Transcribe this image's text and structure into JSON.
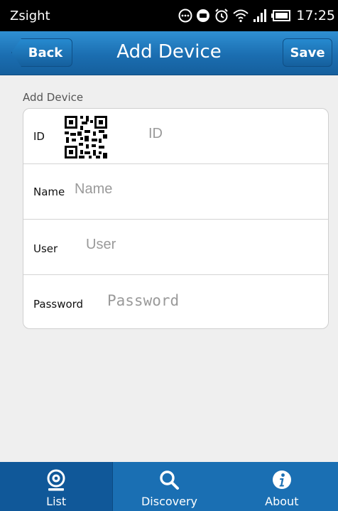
{
  "status_bar": {
    "app_name": "Zsight",
    "time": "17:25"
  },
  "header": {
    "title": "Add Device",
    "back_label": "Back",
    "save_label": "Save"
  },
  "form": {
    "section_label": "Add Device",
    "fields": [
      {
        "label": "ID",
        "placeholder": "ID"
      },
      {
        "label": "Name",
        "placeholder": "Name"
      },
      {
        "label": "User",
        "placeholder": "User"
      },
      {
        "label": "Password",
        "placeholder": "Password"
      }
    ]
  },
  "tabs": [
    {
      "label": "List",
      "icon": "webcam-icon",
      "active": true
    },
    {
      "label": "Discovery",
      "icon": "search-icon",
      "active": false
    },
    {
      "label": "About",
      "icon": "info-icon",
      "active": false
    }
  ],
  "colors": {
    "header_blue": "#1b6eb1",
    "tab_bar_blue": "#1a6fb3",
    "tab_active": "#105899",
    "background": "#efefef"
  }
}
